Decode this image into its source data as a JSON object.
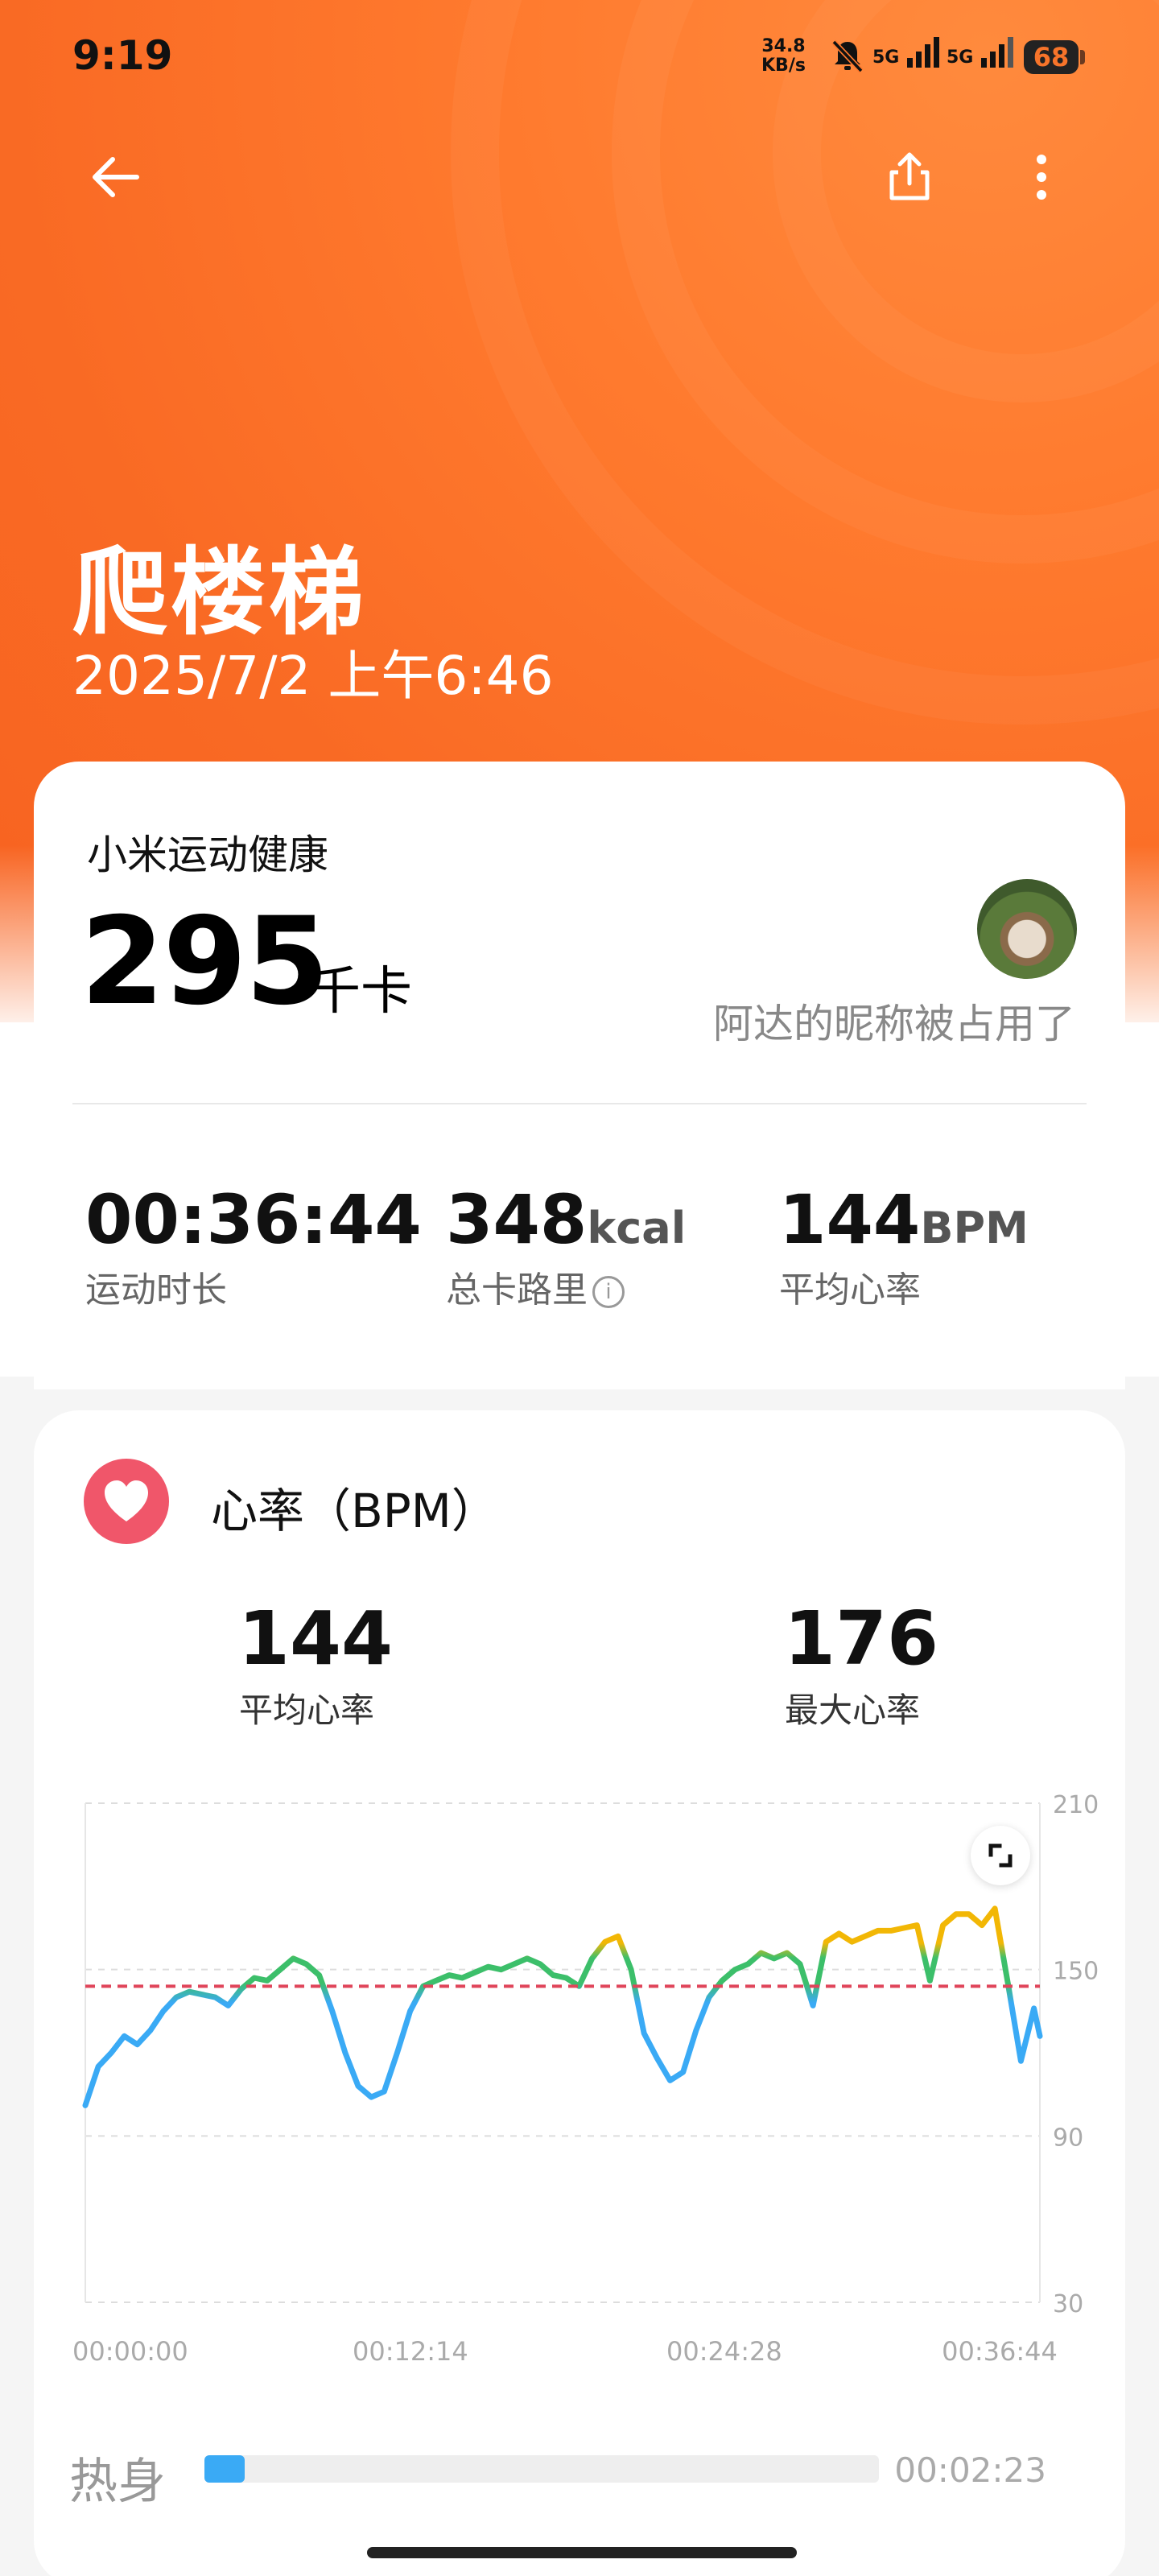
{
  "status_bar": {
    "time": "9:19",
    "net_speed_value": "34.8",
    "net_speed_unit": "KB/s",
    "signal1": "5G",
    "signal2": "5G",
    "battery": "68"
  },
  "header": {
    "back_icon": "arrow-left-icon",
    "share_icon": "share-icon",
    "more_icon": "more-vertical-icon",
    "title": "爬楼梯",
    "date": "2025/7/2 上午6:46"
  },
  "summary": {
    "source": "小米运动健康",
    "calories_value": "295",
    "calories_unit": "千卡",
    "nickname": "阿达的昵称被占用了",
    "stats": [
      {
        "value": "00:36:44",
        "unit": "",
        "label": "运动时长"
      },
      {
        "value": "348",
        "unit": "kcal",
        "label": "总卡路里"
      },
      {
        "value": "144",
        "unit": "BPM",
        "label": "平均心率"
      }
    ]
  },
  "heart_rate": {
    "title": "心率（BPM）",
    "avg_value": "144",
    "avg_label": "平均心率",
    "max_value": "176",
    "max_label": "最大心率",
    "y_ticks": [
      "210",
      "150",
      "90",
      "30"
    ],
    "x_ticks": [
      "00:00:00",
      "00:12:14",
      "00:24:28",
      "00:36:44"
    ],
    "avg_line_color": "#e0455a"
  },
  "chart_data": {
    "type": "line",
    "title": "心率（BPM）",
    "xlabel": "",
    "ylabel": "",
    "ylim": [
      30,
      210
    ],
    "xlim_minutes": [
      0,
      36.73
    ],
    "grid": true,
    "reference_line": {
      "value": 144
    },
    "series": [
      {
        "x": [
          0,
          0.5,
          1,
          1.5,
          2,
          2.5,
          3,
          3.5,
          4,
          4.5,
          5,
          5.5,
          6,
          6.5,
          7,
          7.5,
          8,
          8.5,
          9,
          9.5,
          10,
          10.5,
          11,
          11.5,
          12,
          12.5,
          13,
          13.5,
          14,
          14.5,
          15,
          15.5,
          16,
          16.5,
          17,
          17.5,
          18,
          18.5,
          19,
          19.5,
          20,
          20.5,
          21,
          21.5,
          22,
          22.5,
          23,
          23.5,
          24,
          24.5,
          25,
          25.5,
          26,
          26.5,
          27,
          27.5,
          28,
          28.5,
          29,
          29.5,
          30,
          30.5,
          31,
          31.5,
          32,
          32.5,
          33,
          33.5,
          34,
          34.5,
          35,
          35.5,
          36,
          36.5,
          36.73
        ],
        "values": [
          101,
          115,
          120,
          126,
          123,
          128,
          135,
          140,
          142,
          141,
          140,
          137,
          143,
          147,
          146,
          150,
          154,
          152,
          148,
          135,
          120,
          108,
          104,
          106,
          120,
          135,
          144,
          146,
          148,
          147,
          149,
          151,
          150,
          152,
          154,
          152,
          148,
          147,
          144,
          154,
          160,
          162,
          150,
          127,
          118,
          110,
          113,
          128,
          140,
          146,
          150,
          152,
          156,
          154,
          156,
          152,
          137,
          160,
          163,
          160,
          162,
          164,
          164,
          165,
          166,
          146,
          166,
          170,
          170,
          166,
          172,
          145,
          117,
          136,
          126
        ]
      }
    ]
  },
  "zones": [
    {
      "label": "热身",
      "time": "00:02:23",
      "fraction": 0.06,
      "color": "#3aaaf5"
    }
  ]
}
